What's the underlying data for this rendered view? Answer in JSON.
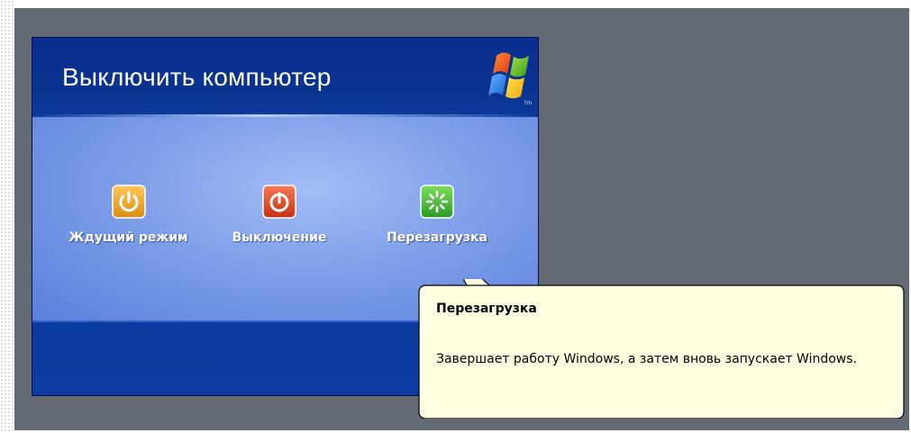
{
  "dialog": {
    "title": "Выключить компьютер",
    "logo_icon": "windows-xp-flag-icon",
    "options": [
      {
        "label": "Ждущий режим",
        "icon": "standby-power-icon",
        "color": "#f0a020"
      },
      {
        "label": "Выключение",
        "icon": "shutdown-power-icon",
        "color": "#dc4020"
      },
      {
        "label": "Перезагрузка",
        "icon": "restart-icon",
        "color": "#3aa83a"
      }
    ]
  },
  "tooltip": {
    "title": "Перезагрузка",
    "text": "Завершает работу Windows, а затем вновь запускает Windows."
  },
  "colors": {
    "backdrop": "#646a73",
    "dialog_header": "#0a2d8f",
    "dialog_body": "#7e9fe9",
    "tooltip_bg": "#ffffe1"
  }
}
